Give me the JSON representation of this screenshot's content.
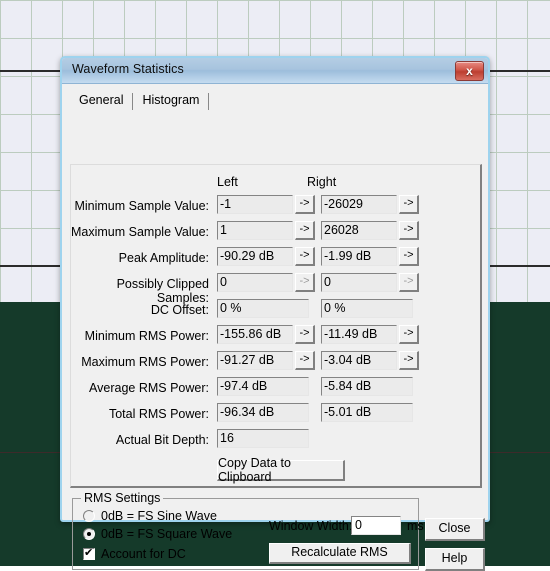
{
  "dialog": {
    "title": "Waveform Statistics",
    "close_icon": "x",
    "tabs": [
      {
        "label": "General",
        "active": true
      },
      {
        "label": "Histogram",
        "active": false
      }
    ],
    "columns": {
      "left": "Left",
      "right": "Right"
    },
    "rows": [
      {
        "label": "Minimum Sample Value:",
        "left": "-1",
        "right": "-26029",
        "left_btn": "->",
        "right_btn": "->",
        "btn_state": "enabled"
      },
      {
        "label": "Maximum Sample Value:",
        "left": "1",
        "right": "26028",
        "left_btn": "->",
        "right_btn": "->",
        "btn_state": "enabled"
      },
      {
        "label": "Peak Amplitude:",
        "left": "-90.29 dB",
        "right": "-1.99 dB",
        "left_btn": "->",
        "right_btn": "->",
        "btn_state": "enabled"
      },
      {
        "label": "Possibly Clipped Samples:",
        "left": "0",
        "right": "0",
        "left_btn": "->",
        "right_btn": "->",
        "btn_state": "disabled"
      },
      {
        "label": "DC Offset:",
        "left": "0 %",
        "right": "0 %",
        "left_btn": "",
        "right_btn": "",
        "btn_state": "none"
      },
      {
        "label": "Minimum RMS Power:",
        "left": "-155.86 dB",
        "right": "-11.49 dB",
        "left_btn": "->",
        "right_btn": "->",
        "btn_state": "enabled"
      },
      {
        "label": "Maximum RMS Power:",
        "left": "-91.27 dB",
        "right": "-3.04 dB",
        "left_btn": "->",
        "right_btn": "->",
        "btn_state": "enabled"
      },
      {
        "label": "Average RMS Power:",
        "left": "-97.4 dB",
        "right": "-5.84 dB",
        "left_btn": "",
        "right_btn": "",
        "btn_state": "none"
      },
      {
        "label": "Total RMS Power:",
        "left": "-96.34 dB",
        "right": "-5.01 dB",
        "left_btn": "",
        "right_btn": "",
        "btn_state": "none"
      },
      {
        "label": "Actual Bit Depth:",
        "left": "16",
        "right": "",
        "left_btn": "",
        "right_btn": "",
        "btn_state": "none"
      }
    ],
    "copy_button": "Copy Data to Clipboard",
    "rms_settings": {
      "legend": "RMS Settings",
      "option_sine": "0dB = FS Sine Wave",
      "option_square": "0dB = FS Square Wave",
      "selected_option": "square",
      "account_for_dc": "Account for DC",
      "account_for_dc_checked": true,
      "window_width_label": "Window Width:",
      "window_width_value": "0",
      "window_width_unit": "ms",
      "recalculate_button": "Recalculate RMS"
    },
    "close_button": "Close",
    "help_button": "Help"
  },
  "background": {
    "grid_color": "#bcccbf",
    "upper_color": "#ecedf5",
    "lower_color": "#153a2a"
  }
}
